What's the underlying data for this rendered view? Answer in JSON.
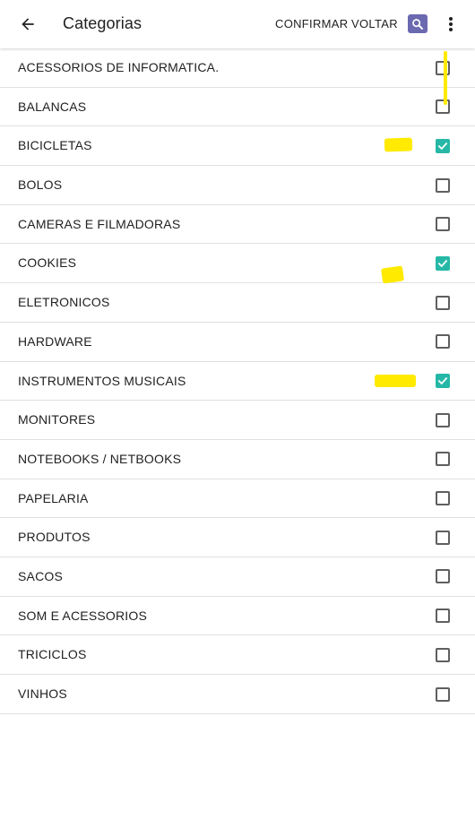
{
  "appbar": {
    "title": "Categorias",
    "confirm_label": "CONFIRMAR",
    "back_label": "VOLTAR",
    "back_icon": "arrow-left-icon",
    "search_icon": "search-icon",
    "more_icon": "more-vert-icon",
    "search_bg_color": "#6b69b0"
  },
  "colors": {
    "checked": "#26b8a6",
    "highlight": "#ffea00"
  },
  "categories": [
    {
      "label": "ACESSORIOS DE INFORMATICA.",
      "checked": false
    },
    {
      "label": "BALANCAS",
      "checked": false
    },
    {
      "label": "BICICLETAS",
      "checked": true
    },
    {
      "label": "BOLOS",
      "checked": false
    },
    {
      "label": "CAMERAS E FILMADORAS",
      "checked": false
    },
    {
      "label": "COOKIES",
      "checked": true
    },
    {
      "label": "ELETRONICOS",
      "checked": false
    },
    {
      "label": "HARDWARE",
      "checked": false
    },
    {
      "label": "INSTRUMENTOS MUSICAIS",
      "checked": true
    },
    {
      "label": "MONITORES",
      "checked": false
    },
    {
      "label": "NOTEBOOKS / NETBOOKS",
      "checked": false
    },
    {
      "label": "PAPELARIA",
      "checked": false
    },
    {
      "label": "PRODUTOS",
      "checked": false
    },
    {
      "label": "SACOS",
      "checked": false
    },
    {
      "label": "SOM E ACESSORIOS",
      "checked": false
    },
    {
      "label": "TRICICLOS",
      "checked": false
    },
    {
      "label": "VINHOS",
      "checked": false
    }
  ]
}
